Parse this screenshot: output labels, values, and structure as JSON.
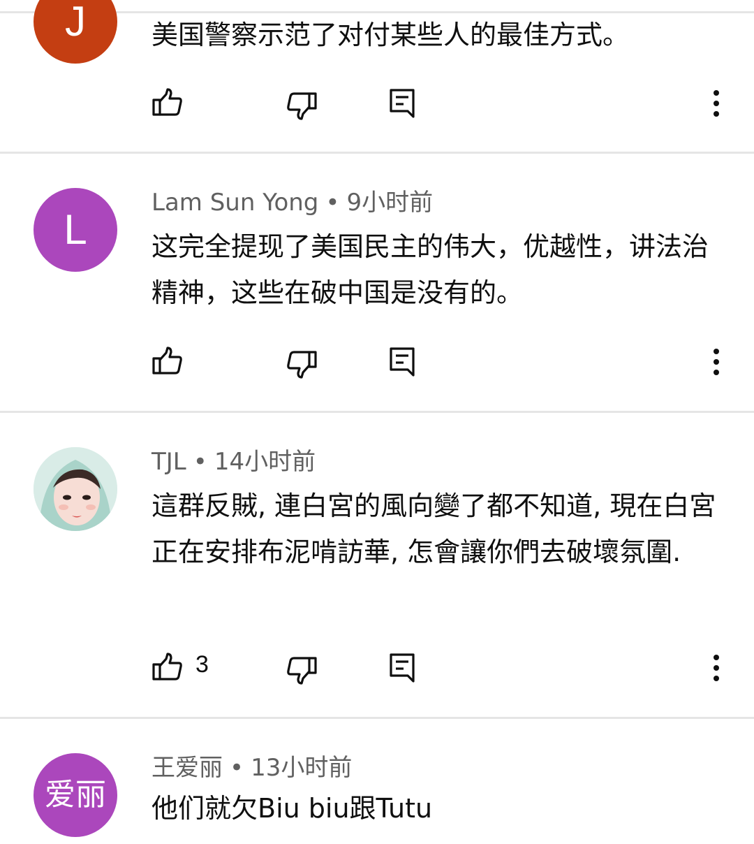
{
  "comments": [
    {
      "author": "",
      "time": "",
      "avatar_letter": "J",
      "avatar_color": "#c43e12",
      "text": "美国警察示范了对付某些人的最佳方式。",
      "likes": ""
    },
    {
      "author": "Lam Sun Yong",
      "time": "9小时前",
      "avatar_letter": "L",
      "avatar_color": "#ab47bc",
      "text": "这完全提现了美国民主的伟大，优越性，讲法治精神，这些在破中国是没有的。",
      "likes": ""
    },
    {
      "author": "TJL",
      "time": "14小时前",
      "avatar_letter": "",
      "avatar_color": "#d9ece7",
      "text": "這群反賊, 連白宮的風向變了都不知道, 現在白宮正在安排布泥啃訪華, 怎會讓你們去破壞氛圍.",
      "likes": "3"
    },
    {
      "author": "王爱丽",
      "time": "13小时前",
      "avatar_letter": "爱丽",
      "avatar_color": "#ab47bc",
      "text": "他们就欠Biu biu跟Tutu",
      "likes": ""
    }
  ],
  "separator": "•",
  "icons": {
    "like": "thumbs-up-icon",
    "dislike": "thumbs-down-icon",
    "reply": "reply-comment-icon",
    "more": "more-vertical-icon"
  }
}
